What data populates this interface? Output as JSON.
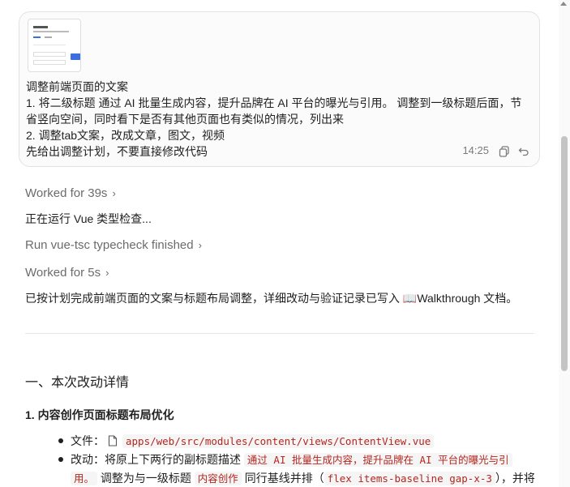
{
  "user_message": {
    "lines": [
      "调整前端页面的文案",
      "1. 将二级标题 通过 AI 批量生成内容，提升品牌在 AI 平台的曝光与引用。 调整到一级标题后面，节",
      "省竖向空间，同时看下是否有其他页面也有类似的情况，列出来",
      "2. 调整tab文案，改成文章，图文，视频",
      "先给出调整计划，不要直接修改代码"
    ],
    "time": "14:25"
  },
  "activity": {
    "worked_1": "Worked for 39s",
    "running": "正在运行 Vue 类型检查...",
    "typecheck": "Run vue-tsc typecheck finished",
    "worked_2": "Worked for 5s"
  },
  "summary": {
    "text_before": "已按计划完成前端页面的文案与标题布局调整，详细改动与验证记录已写入 ",
    "walkthrough_icon": "📖",
    "walkthrough_label": "Walkthrough",
    "text_after": " 文档。"
  },
  "details": {
    "heading": "一、本次改动详情",
    "item1_title": "1. 内容创作页面标题布局优化",
    "file_label": "文件：",
    "file_path": "apps/web/src/modules/content/views/ContentView.vue",
    "change_label": "改动：将原上下两行的副标题描述 ",
    "change_code1": "通过 AI 批量生成内容，提升品牌在 AI 平台的曝光与引",
    "change_code1b": "用。",
    "change_mid": " 调整为与一级标题 ",
    "change_code2": "内容创作",
    "change_mid2": " 同行基线并排（",
    "change_code3": "flex items-baseline gap-x-3",
    "change_end": "），并将"
  }
}
